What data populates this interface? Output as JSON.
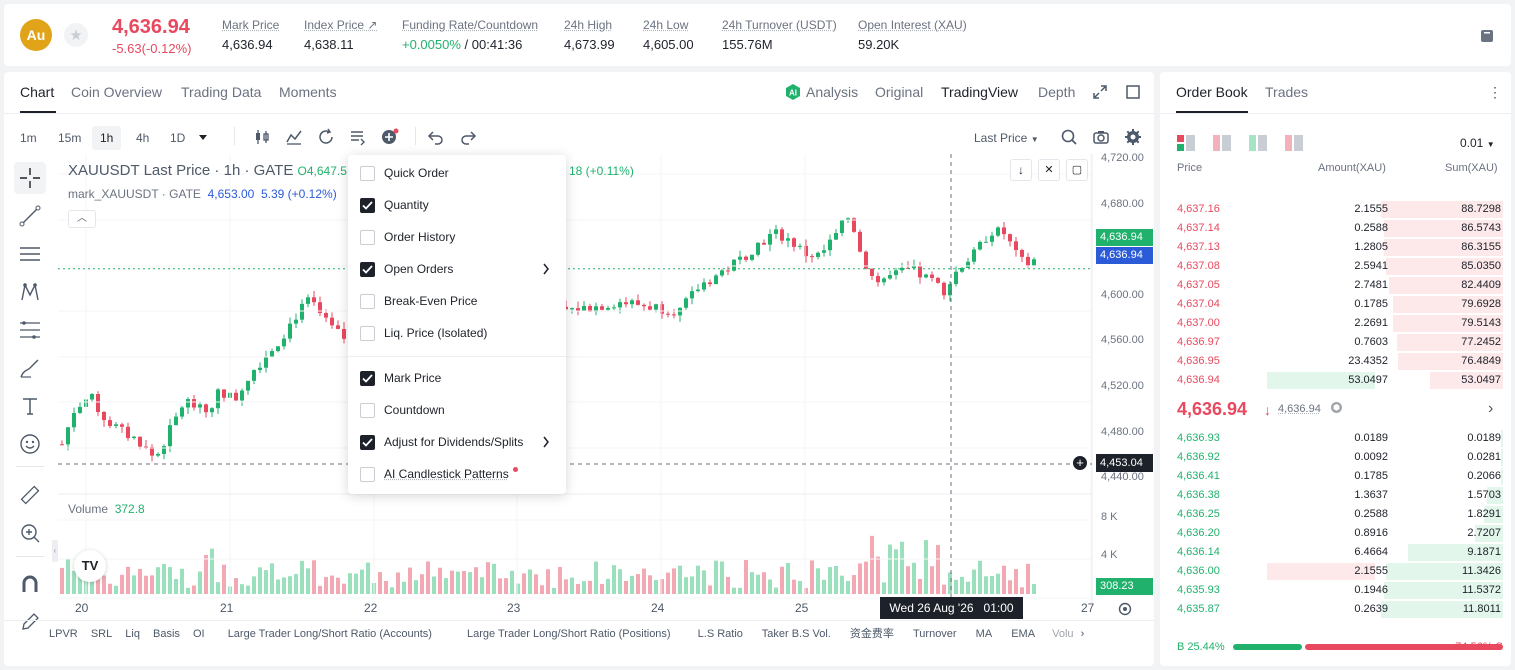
{
  "ticker": {
    "logo": "Au",
    "last_price": "4,636.94",
    "change": "-5.63(-0.12%)",
    "stats": [
      {
        "label": "Mark Price",
        "value": "4,636.94"
      },
      {
        "label": "Index Price ↗",
        "value": "4,638.11"
      },
      {
        "label": "Funding Rate/Countdown",
        "value_green": "+0.0050%",
        "value": " / 00:41:36"
      },
      {
        "label": "24h High",
        "value": "4,673.99"
      },
      {
        "label": "24h Low",
        "value": "4,605.00"
      },
      {
        "label": "24h Turnover (USDT)",
        "value": "155.76M"
      },
      {
        "label": "Open Interest (XAU)",
        "value": "59.20K"
      }
    ]
  },
  "chart_panel": {
    "tabs": [
      "Chart",
      "Coin Overview",
      "Trading Data",
      "Moments"
    ],
    "views": [
      "Analysis",
      "Original",
      "TradingView",
      "Depth"
    ],
    "timeframes": [
      "1m",
      "15m",
      "1h",
      "4h",
      "1D"
    ],
    "price_type": "Last Price",
    "legend": {
      "title": "XAUUSDT Last Price · 1h · GATE",
      "ohlc_partial": "O4,647.5",
      "change_partial": "18 (+0.11%)",
      "mark_label": "mark_XAUUSDT · GATE",
      "mark_value": "4,653.00",
      "mark_change": "5.39 (+0.12%)"
    },
    "volume_label": "Volume",
    "volume_value": "372.8",
    "crosshair_date": "Wed 26 Aug '26   01:00",
    "price_axis": [
      "4,720.00",
      "4,680.00",
      "4,600.00",
      "4,560.00",
      "4,520.00",
      "4,480.00",
      "4,440.00"
    ],
    "volume_axis": [
      "8 K",
      "4 K"
    ],
    "last_price_tag": "4,636.94",
    "mark_price_tag": "4,636.94",
    "crosshair_price_tag": "4,453.04",
    "volume_tag": "308.23",
    "date_axis": [
      "20",
      "21",
      "22",
      "23",
      "24",
      "25",
      "27"
    ],
    "indicators": [
      "LPVR",
      "SRL",
      "Liq",
      "Basis",
      "OI",
      "Large Trader Long/Short Ratio (Accounts)",
      "Large Trader Long/Short Ratio (Positions)",
      "L.S Ratio",
      "Taker B.S Vol.",
      "资金费率",
      "Turnover",
      "MA",
      "EMA",
      "Volu"
    ]
  },
  "menu": {
    "items": [
      {
        "label": "Quick Order",
        "checked": false
      },
      {
        "label": "Quantity",
        "checked": true
      },
      {
        "label": "Order History",
        "checked": false
      },
      {
        "label": "Open Orders",
        "checked": true,
        "submenu": true
      },
      {
        "label": "Break-Even Price",
        "checked": false
      },
      {
        "label": "Liq. Price (Isolated)",
        "checked": false
      },
      {
        "label": "Mark Price",
        "checked": true
      },
      {
        "label": "Countdown",
        "checked": false
      },
      {
        "label": "Adjust for Dividends/Splits",
        "checked": true,
        "submenu": true
      },
      {
        "label": "AI Candlestick Patterns",
        "checked": false,
        "dot": true
      }
    ]
  },
  "order_book": {
    "tabs": [
      "Order Book",
      "Trades"
    ],
    "precision": "0.01",
    "headers": [
      "Price",
      "Amount(XAU)",
      "Sum(XAU)"
    ],
    "asks": [
      {
        "price": "4,637.16",
        "amount": "2.1555",
        "sum": "88.7298"
      },
      {
        "price": "4,637.14",
        "amount": "0.2588",
        "sum": "86.5743"
      },
      {
        "price": "4,637.13",
        "amount": "1.2805",
        "sum": "86.3155"
      },
      {
        "price": "4,637.08",
        "amount": "2.5941",
        "sum": "85.0350"
      },
      {
        "price": "4,637.05",
        "amount": "2.7481",
        "sum": "82.4409"
      },
      {
        "price": "4,637.04",
        "amount": "0.1785",
        "sum": "79.6928"
      },
      {
        "price": "4,637.00",
        "amount": "2.2691",
        "sum": "79.5143"
      },
      {
        "price": "4,636.97",
        "amount": "0.7603",
        "sum": "77.2452"
      },
      {
        "price": "4,636.95",
        "amount": "23.4352",
        "sum": "76.4849"
      },
      {
        "price": "4,636.94",
        "amount": "53.0497",
        "sum": "53.0497"
      }
    ],
    "mid_price": "4,636.94",
    "mid_arrow": "↓",
    "mid_mark": "4,636.94",
    "bids": [
      {
        "price": "4,636.93",
        "amount": "0.0189",
        "sum": "0.0189"
      },
      {
        "price": "4,636.92",
        "amount": "0.0092",
        "sum": "0.0281"
      },
      {
        "price": "4,636.41",
        "amount": "0.1785",
        "sum": "0.2066"
      },
      {
        "price": "4,636.38",
        "amount": "1.3637",
        "sum": "1.5703"
      },
      {
        "price": "4,636.25",
        "amount": "0.2588",
        "sum": "1.8291"
      },
      {
        "price": "4,636.20",
        "amount": "0.8916",
        "sum": "2.7207"
      },
      {
        "price": "4,636.14",
        "amount": "6.4664",
        "sum": "9.1871"
      },
      {
        "price": "4,636.00",
        "amount": "2.1555",
        "sum": "11.3426"
      },
      {
        "price": "4,635.93",
        "amount": "0.1946",
        "sum": "11.5372"
      },
      {
        "price": "4,635.87",
        "amount": "0.2639",
        "sum": "11.8011"
      }
    ],
    "buy_ratio": "B 25.44%",
    "sell_ratio": "74.56% S",
    "buy_ratio_value": 25.44
  },
  "colors": {
    "up": "#20b26c",
    "down": "#e8495f",
    "gold": "#e1a419",
    "mark_blue": "#2c5bd8"
  }
}
